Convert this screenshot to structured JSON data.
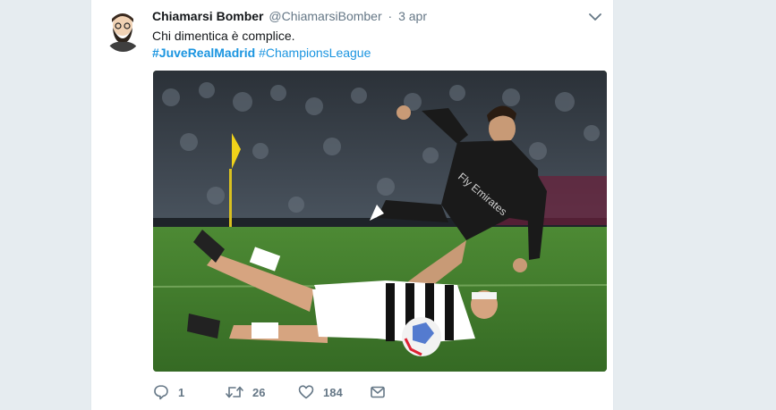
{
  "tweet": {
    "fullname": "Chiamarsi Bomber",
    "username": "@ChiamarsiBomber",
    "separator": "·",
    "time": "3 apr",
    "text": "Chi dimentica è complice.",
    "hashtags": [
      "#JuveRealMadrid",
      "#ChampionsLeague"
    ],
    "media_icon": "photo-football-match"
  },
  "actions": {
    "reply_count": "1",
    "retweet_count": "26",
    "like_count": "184"
  },
  "colors": {
    "link": "#1b95e0",
    "muted": "#657786",
    "background": "#e6ecf0"
  }
}
